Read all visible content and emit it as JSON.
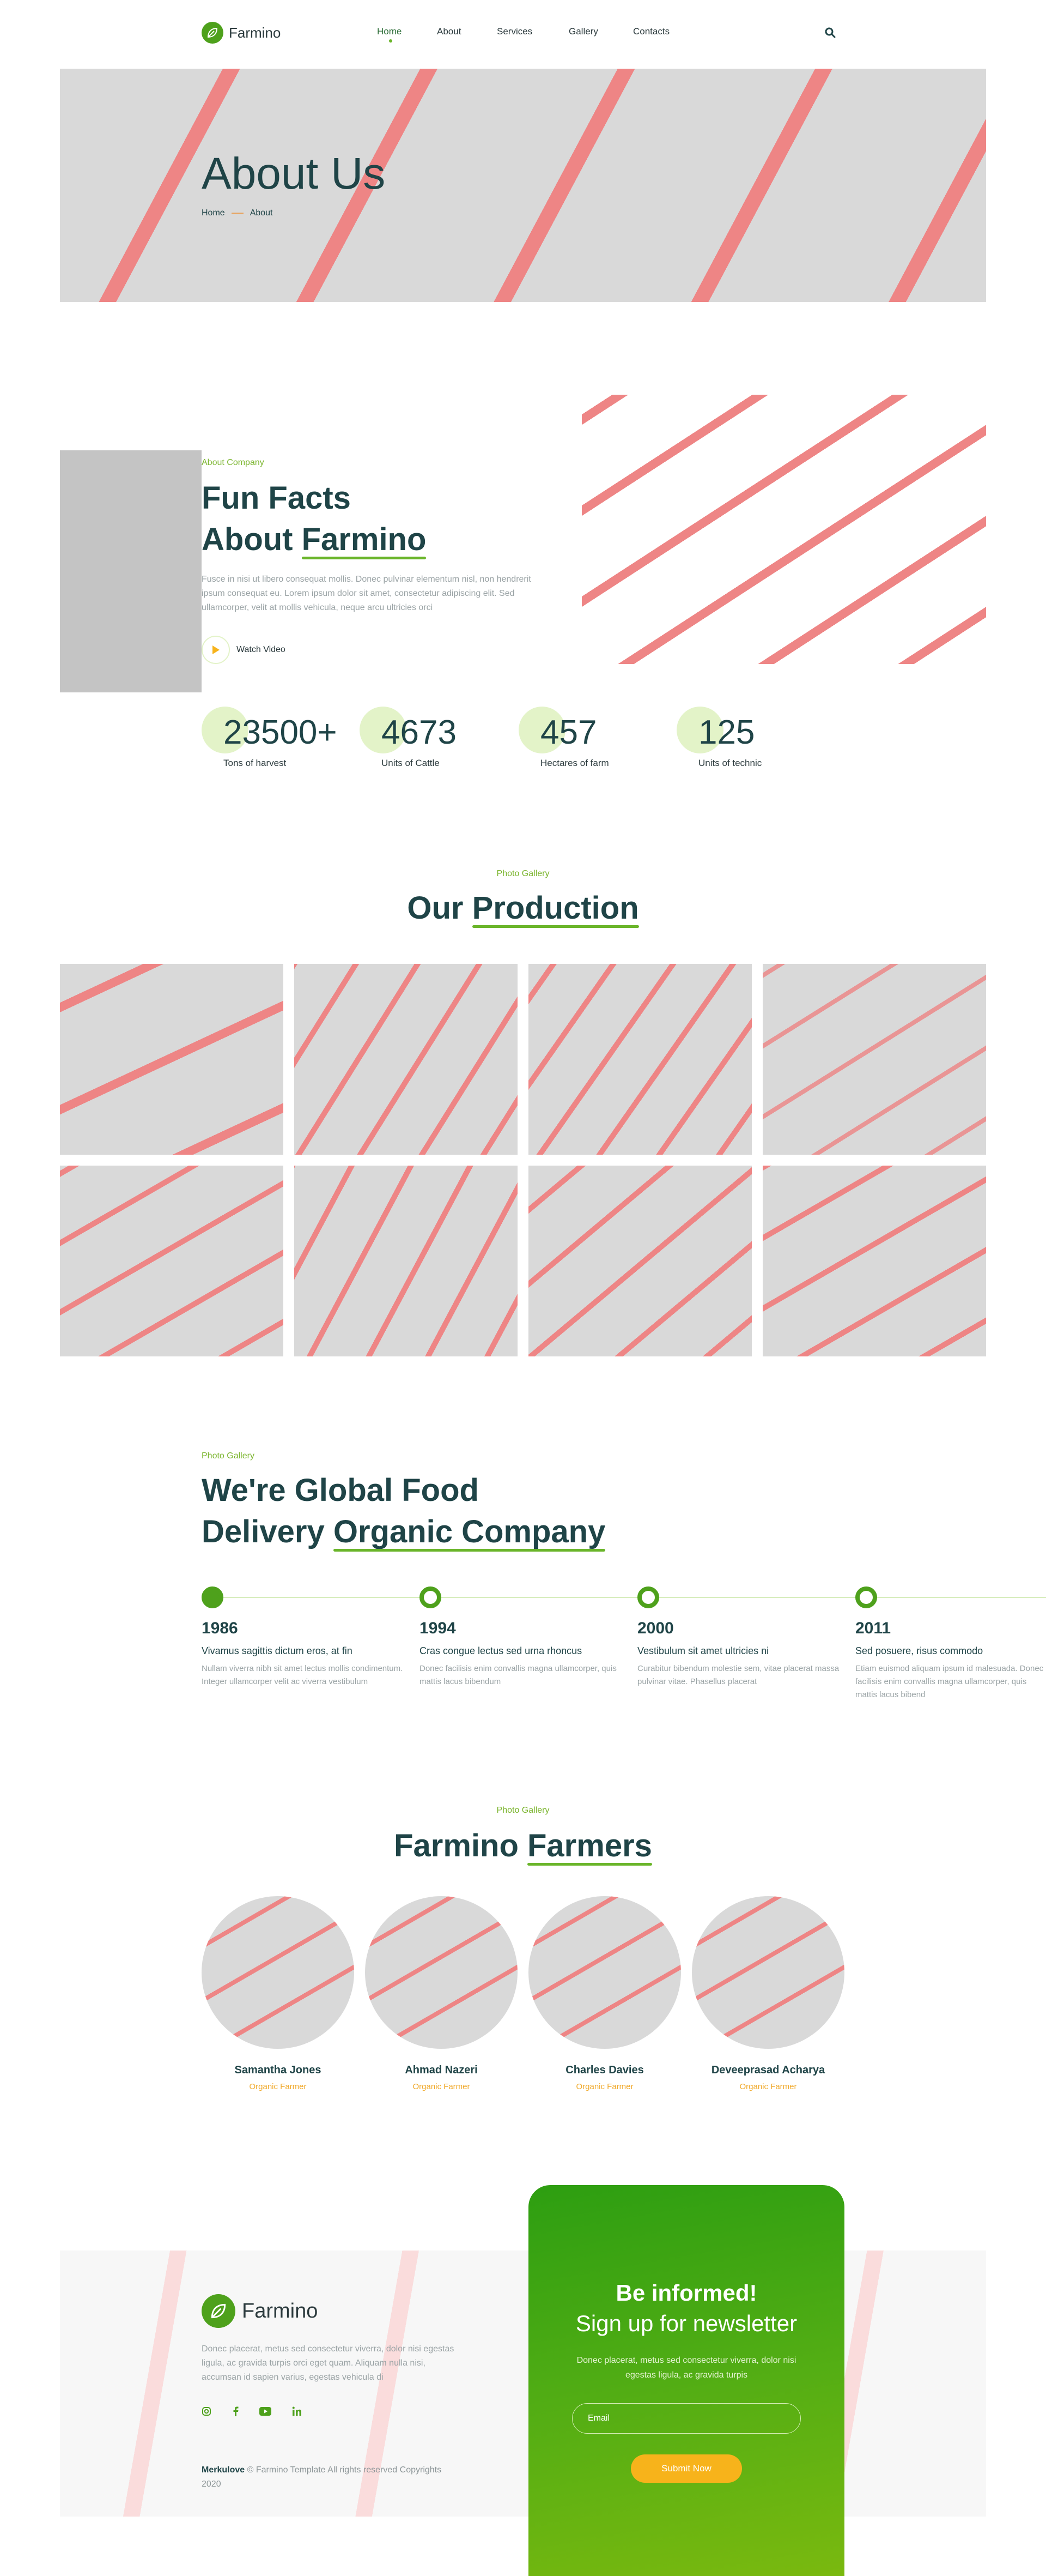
{
  "header": {
    "brand": "Farmino",
    "nav": [
      "Home",
      "About",
      "Services",
      "Gallery",
      "Contacts"
    ],
    "active_nav": "Home"
  },
  "hero": {
    "title": "About Us",
    "breadcrumb": [
      "Home",
      "About"
    ]
  },
  "about": {
    "eyebrow": "About Company",
    "title_line1": "Fun Facts",
    "title_line2_plain": "About ",
    "title_line2_accent": "Farmino",
    "text": "Fusce in nisi ut libero consequat mollis. Donec pulvinar elementum nisl, non hendrerit ipsum consequat eu. Lorem ipsum dolor sit amet, consectetur adipiscing elit. Sed ullamcorper, velit at mollis vehicula, neque arcu ultricies orci",
    "video_label": "Watch Video"
  },
  "stats": [
    {
      "value": "23500+",
      "label": "Tons of harvest"
    },
    {
      "value": "4673",
      "label": "Units of Cattle"
    },
    {
      "value": "457",
      "label": "Hectares of farm"
    },
    {
      "value": "125",
      "label": "Units of technic"
    }
  ],
  "production": {
    "eyebrow": "Photo Gallery",
    "title_plain": "Our ",
    "title_accent": "Production"
  },
  "history": {
    "eyebrow": "Photo Gallery",
    "title_line1": "We're Global Food",
    "title_line2_plain": "Delivery ",
    "title_line2_accent": "Organic Company",
    "items": [
      {
        "year": "1986",
        "title": "Vivamus sagittis dictum eros, at fin",
        "text": "Nullam viverra nibh sit amet lectus mollis condimentum. Integer ullamcorper velit ac viverra vestibulum"
      },
      {
        "year": "1994",
        "title": "Cras congue lectus sed urna rhoncus",
        "text": "Donec facilisis enim convallis magna ullamcorper, quis mattis lacus bibendum"
      },
      {
        "year": "2000",
        "title": "Vestibulum sit amet ultricies ni",
        "text": "Curabitur bibendum molestie sem, vitae placerat massa pulvinar vitae. Phasellus placerat"
      },
      {
        "year": "2011",
        "title": "Sed posuere, risus commodo",
        "text": "Etiam euismod aliquam ipsum id malesuada. Donec facilisis enim convallis magna ullamcorper, quis mattis lacus bibend"
      }
    ]
  },
  "farmers": {
    "eyebrow": "Photo Gallery",
    "title_plain": "Farmino ",
    "title_accent": "Farmers",
    "people": [
      {
        "name": "Samantha Jones",
        "role": "Organic Farmer"
      },
      {
        "name": "Ahmad Nazeri",
        "role": "Organic Farmer"
      },
      {
        "name": "Charles Davies",
        "role": "Organic Farmer"
      },
      {
        "name": "Deveeprasad Acharya",
        "role": "Organic Farmer"
      }
    ]
  },
  "footer": {
    "brand": "Farmino",
    "text": "Donec placerat, metus sed consectetur viverra, dolor nisi egestas ligula, ac gravida turpis orci eget quam. Aliquam nulla nisi, accumsan id sapien varius, egestas vehicula di",
    "social_icons": [
      "instagram-icon",
      "facebook-icon",
      "youtube-icon",
      "linkedin-icon"
    ],
    "copyright_brand": "Merkulove",
    "copyright_rest": " © Farmino Template All rights reserved Copyrights 2020"
  },
  "newsletter": {
    "title": "Be informed!",
    "subtitle": "Sign up for newsletter",
    "text": "Donec placerat, metus sed consectetur viverra, dolor nisi egestas ligula, ac gravida turpis",
    "email_placeholder": "Email",
    "submit_label": "Submit Now"
  },
  "colors": {
    "primary_green": "#4ea11c",
    "accent_green": "#6ab52a",
    "heading": "#1f4447",
    "accent_yellow": "#f7b31b"
  }
}
